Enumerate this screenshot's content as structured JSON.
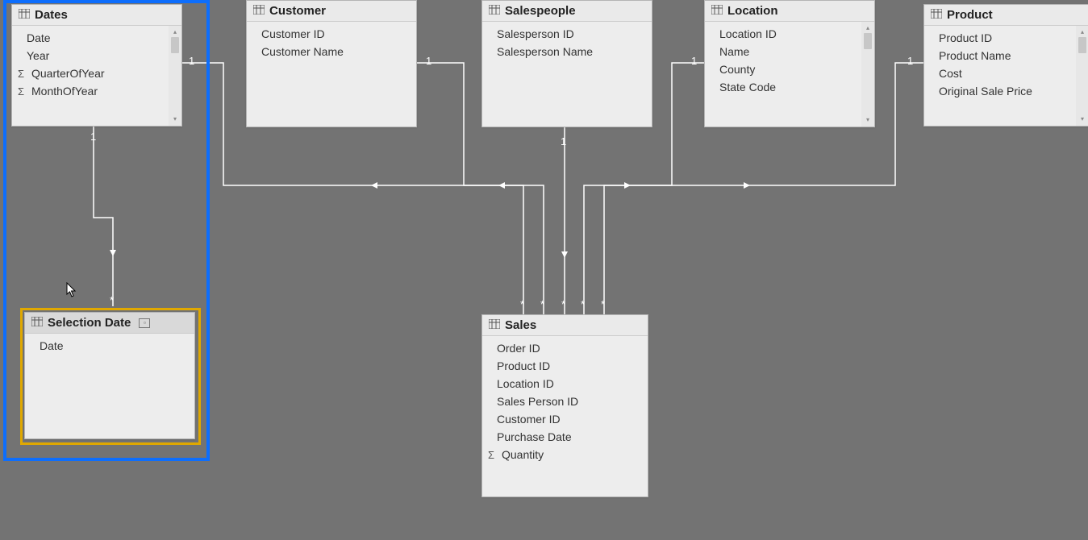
{
  "tables": {
    "dates": {
      "title": "Dates",
      "fields": [
        {
          "name": "Date",
          "sigma": false
        },
        {
          "name": "Year",
          "sigma": false
        },
        {
          "name": "QuarterOfYear",
          "sigma": true
        },
        {
          "name": "MonthOfYear",
          "sigma": true
        }
      ]
    },
    "customer": {
      "title": "Customer",
      "fields": [
        {
          "name": "Customer ID",
          "sigma": false
        },
        {
          "name": "Customer Name",
          "sigma": false
        }
      ]
    },
    "salespeople": {
      "title": "Salespeople",
      "fields": [
        {
          "name": "Salesperson ID",
          "sigma": false
        },
        {
          "name": "Salesperson Name",
          "sigma": false
        }
      ]
    },
    "location": {
      "title": "Location",
      "fields": [
        {
          "name": "Location ID",
          "sigma": false
        },
        {
          "name": "Name",
          "sigma": false
        },
        {
          "name": "County",
          "sigma": false
        },
        {
          "name": "State Code",
          "sigma": false
        }
      ]
    },
    "product": {
      "title": "Product",
      "fields": [
        {
          "name": "Product ID",
          "sigma": false
        },
        {
          "name": "Product Name",
          "sigma": false
        },
        {
          "name": "Cost",
          "sigma": false
        },
        {
          "name": "Original Sale Price",
          "sigma": false
        }
      ]
    },
    "selection_date": {
      "title": "Selection Date",
      "fields": [
        {
          "name": "Date",
          "sigma": false
        }
      ]
    },
    "sales": {
      "title": "Sales",
      "fields": [
        {
          "name": "Order ID",
          "sigma": false
        },
        {
          "name": "Product ID",
          "sigma": false
        },
        {
          "name": "Location ID",
          "sigma": false
        },
        {
          "name": "Sales Person ID",
          "sigma": false
        },
        {
          "name": "Customer ID",
          "sigma": false
        },
        {
          "name": "Purchase Date",
          "sigma": false
        },
        {
          "name": "Quantity",
          "sigma": true
        }
      ]
    }
  },
  "cardinality": {
    "one": "1",
    "many": "*"
  },
  "relationships": [
    {
      "from": "dates",
      "to": "selection_date",
      "from_card": "1",
      "to_card": "*"
    },
    {
      "from": "dates",
      "to": "sales",
      "from_card": "1",
      "to_card": "*"
    },
    {
      "from": "customer",
      "to": "sales",
      "from_card": "1",
      "to_card": "*"
    },
    {
      "from": "salespeople",
      "to": "sales",
      "from_card": "1",
      "to_card": "*"
    },
    {
      "from": "location",
      "to": "sales",
      "from_card": "1",
      "to_card": "*"
    },
    {
      "from": "product",
      "to": "sales",
      "from_card": "1",
      "to_card": "*"
    }
  ]
}
